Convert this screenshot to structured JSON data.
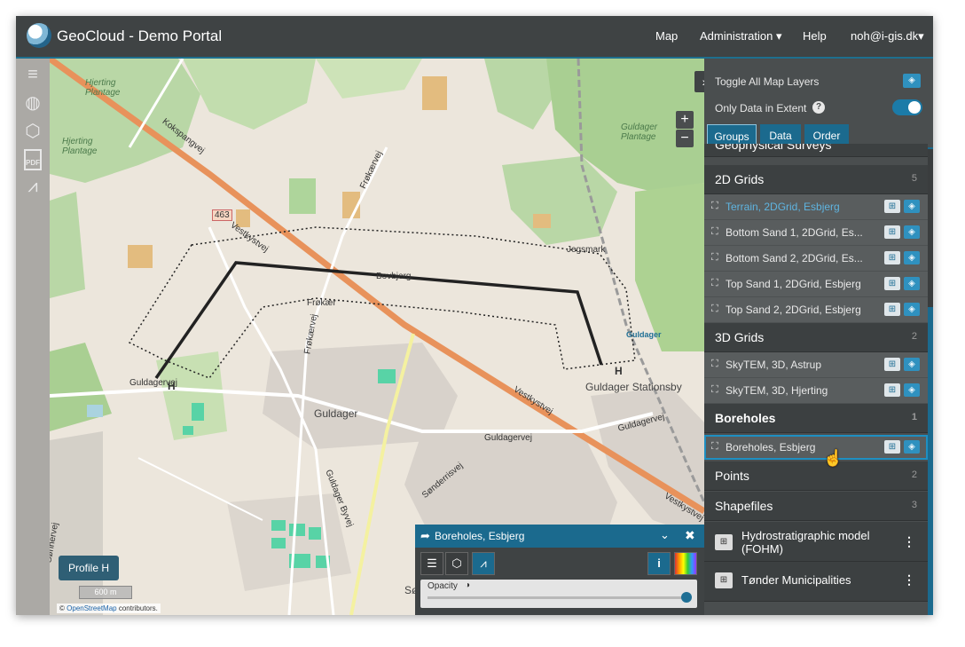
{
  "header": {
    "title": "GeoCloud - Demo Portal",
    "nav": [
      "Map",
      "Administration",
      "Help",
      "noh@i-gis.dk"
    ]
  },
  "left_tools": [
    {
      "icon": "layers-icon"
    },
    {
      "icon": "globe-icon"
    },
    {
      "icon": "cube-icon"
    },
    {
      "icon": "pdf-icon",
      "text": "PDF"
    },
    {
      "icon": "chart-icon"
    }
  ],
  "map": {
    "labels": {
      "hjerting_plantage_1": "Hjerting\nPlantage",
      "hjerting_plantage_2": "Hjerting\nPlantage",
      "guldager_plantage": "Guldager\nPlantage",
      "koksspangvej": "Kokspangvej",
      "frokaervej": "Frøkærvej",
      "road_463": "463",
      "vestkystvej_1": "Vestkystvej",
      "vestkystvej_2": "Vestkystvej",
      "vestkystvej_3": "Vestkystvej",
      "bovbjerg": "Bovbjerg",
      "jegsmark": "Jegsmark",
      "frokaer": "Frøkær",
      "frokaervej_2": "Frøkærvej",
      "guldager_sign": "Guldager",
      "guldager_stationsby": "Guldager Stationsby",
      "guldager": "Guldager",
      "guldagervej_1": "Guldagervej",
      "guldagervej_2": "Guldagervej",
      "guldagervej_3": "Guldagervej",
      "guldager_byvej": "Guldager Byvej",
      "sonderrisvej": "Sønderrisvej",
      "sonderris": "Sønderris",
      "sonnervej": "Sønnervej",
      "marker_h1": "H",
      "marker_h2": "H"
    },
    "zoom_in": "+",
    "zoom_out": "−",
    "profile_button": "Profile H",
    "scale": "600 m",
    "attribution_prefix": "©",
    "attribution_link": "OpenStreetMap",
    "attribution_suffix": "contributors."
  },
  "popup": {
    "title": "Boreholes, Esbjerg",
    "opacity_label": "Opacity",
    "opacity_value": 1.0
  },
  "panel": {
    "toggle_all": "Toggle All Map Layers",
    "only_extent": "Only Data in Extent",
    "only_extent_on": true,
    "tabs": [
      "Groups",
      "Data",
      "Order"
    ],
    "partial_group": "Geophysical Surveys",
    "groups": [
      {
        "name": "2D Grids",
        "count": "5",
        "layers": [
          "Terrain, 2DGrid, Esbjerg",
          "Bottom Sand 1, 2DGrid, Es...",
          "Bottom Sand 2, 2DGrid, Es...",
          "Top Sand 1, 2DGrid, Esbjerg",
          "Top Sand 2, 2DGrid, Esbjerg"
        ]
      },
      {
        "name": "3D Grids",
        "count": "2",
        "layers": [
          "SkyTEM, 3D, Astrup",
          "SkyTEM, 3D, Hjerting"
        ]
      },
      {
        "name": "Boreholes",
        "count": "1",
        "layers": [
          "Boreholes, Esbjerg"
        ]
      },
      {
        "name": "Points",
        "count": "2",
        "layers": []
      },
      {
        "name": "Shapefiles",
        "count": "3",
        "layers": []
      }
    ],
    "files": [
      "Hydrostratigraphic model\n(FOHM)",
      "Tønder Municipalities"
    ],
    "colors": {
      "accent": "#1b6a8e",
      "active_layer_text": "#5fb4e0"
    }
  }
}
